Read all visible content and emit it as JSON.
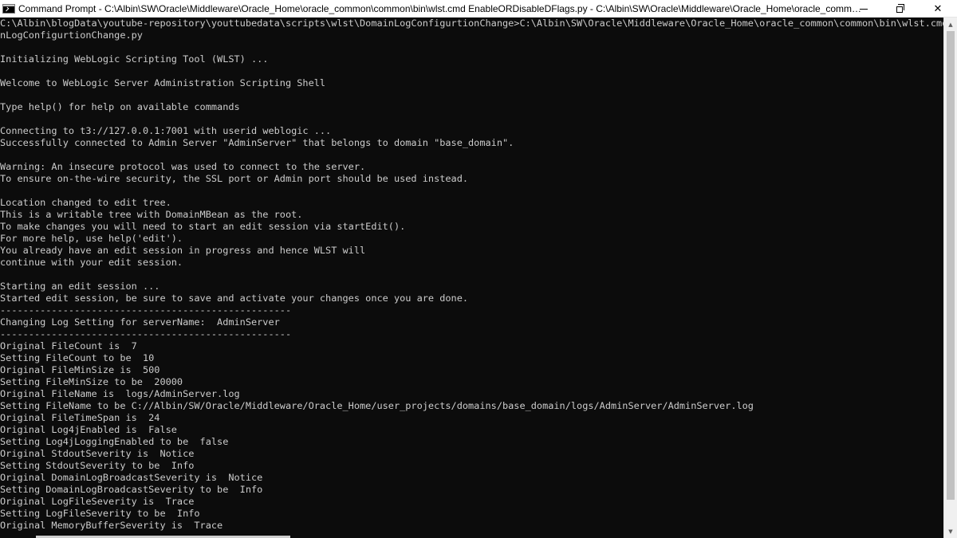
{
  "window": {
    "title": "Command Prompt - C:\\Albin\\SW\\Oracle\\Middleware\\Oracle_Home\\oracle_common\\common\\bin\\wlst.cmd  EnableORDisableDFlags.py - C:\\Albin\\SW\\Oracle\\Middleware\\Oracle_Home\\oracle_common\\commo...",
    "minimize_symbol": "",
    "close_symbol": "✕"
  },
  "console": {
    "lines": [
      "C:\\Albin\\blogData\\youtube-repository\\youttubedata\\scripts\\wlst\\DomainLogConfigurtionChange>C:\\Albin\\SW\\Oracle\\Middleware\\Oracle_Home\\oracle_common\\common\\bin\\wlst.cmd Domai",
      "nLogConfigurtionChange.py",
      "",
      "Initializing WebLogic Scripting Tool (WLST) ...",
      "",
      "Welcome to WebLogic Server Administration Scripting Shell",
      "",
      "Type help() for help on available commands",
      "",
      "Connecting to t3://127.0.0.1:7001 with userid weblogic ...",
      "Successfully connected to Admin Server \"AdminServer\" that belongs to domain \"base_domain\".",
      "",
      "Warning: An insecure protocol was used to connect to the server.",
      "To ensure on-the-wire security, the SSL port or Admin port should be used instead.",
      "",
      "Location changed to edit tree.",
      "This is a writable tree with DomainMBean as the root.",
      "To make changes you will need to start an edit session via startEdit().",
      "For more help, use help('edit').",
      "You already have an edit session in progress and hence WLST will",
      "continue with your edit session.",
      "",
      "Starting an edit session ...",
      "Started edit session, be sure to save and activate your changes once you are done.",
      "---------------------------------------------------",
      "Changing Log Setting for serverName:  AdminServer",
      "---------------------------------------------------",
      "Original FileCount is  7",
      "Setting FileCount to be  10",
      "Original FileMinSize is  500",
      "Setting FileMinSize to be  20000",
      "Original FileName is  logs/AdminServer.log",
      "Setting FileName to be C://Albin/SW/Oracle/Middleware/Oracle_Home/user_projects/domains/base_domain/logs/AdminServer/AdminServer.log",
      "Original FileTimeSpan is  24",
      "Original Log4jEnabled is  False",
      "Setting Log4jLoggingEnabled to be  false",
      "Original StdoutSeverity is  Notice",
      "Setting StdoutSeverity to be  Info",
      "Original DomainLogBroadcastSeverity is  Notice",
      "Setting DomainLogBroadcastSeverity to be  Info",
      "Original LogFileSeverity is  Trace",
      "Setting LogFileSeverity to be  Info",
      "Original MemoryBufferSeverity is  Trace"
    ]
  },
  "colors": {
    "console_background": "#0c0c0c",
    "console_text": "#cccccc",
    "titlebar_background": "#ffffff"
  },
  "scrollbar": {
    "vertical_thumb_fraction": 0.95,
    "horizontal_thumb_fraction": 0.27
  }
}
